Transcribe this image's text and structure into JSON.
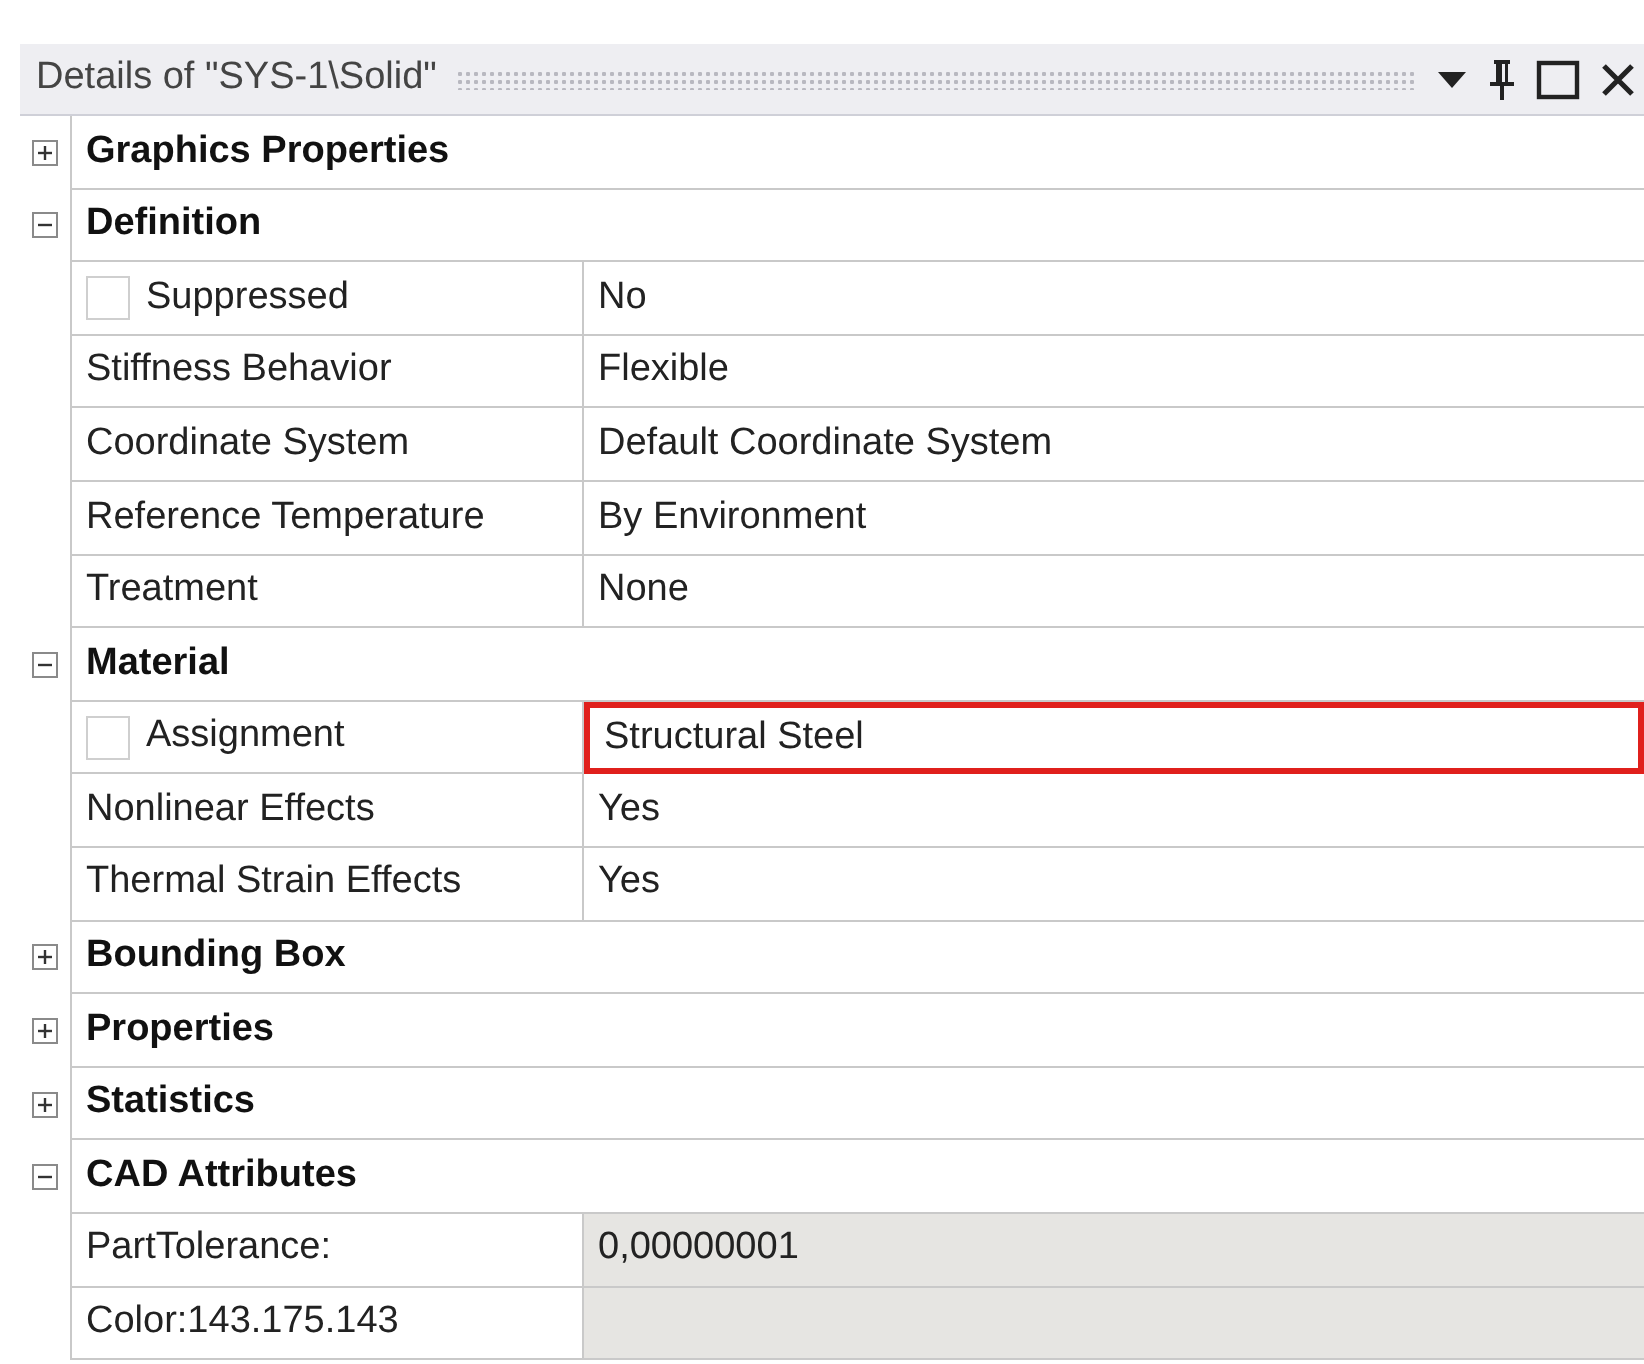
{
  "panel": {
    "title": "Details of \"SYS-1\\Solid\""
  },
  "sections": [
    {
      "title": "Graphics Properties",
      "expanded": false
    },
    {
      "title": "Definition",
      "expanded": true,
      "rows": [
        {
          "label": "Suppressed",
          "value": "No",
          "checked": false
        },
        {
          "label": "Stiffness Behavior",
          "value": "Flexible"
        },
        {
          "label": "Coordinate System",
          "value": "Default Coordinate System"
        },
        {
          "label": "Reference Temperature",
          "value": "By Environment"
        },
        {
          "label": "Treatment",
          "value": "None"
        }
      ]
    },
    {
      "title": "Material",
      "expanded": true,
      "rows": [
        {
          "label": "Assignment",
          "value": "Structural Steel",
          "checked": false,
          "highlighted": true
        },
        {
          "label": "Nonlinear Effects",
          "value": "Yes"
        },
        {
          "label": "Thermal Strain Effects",
          "value": "Yes"
        }
      ]
    },
    {
      "title": "Bounding Box",
      "expanded": false
    },
    {
      "title": "Properties",
      "expanded": false
    },
    {
      "title": "Statistics",
      "expanded": false
    },
    {
      "title": "CAD Attributes",
      "expanded": true,
      "rows": [
        {
          "label": "PartTolerance:",
          "value": "0,00000001",
          "readonly": true
        },
        {
          "label": "Color:143.175.143",
          "readonly": true
        }
      ]
    }
  ]
}
